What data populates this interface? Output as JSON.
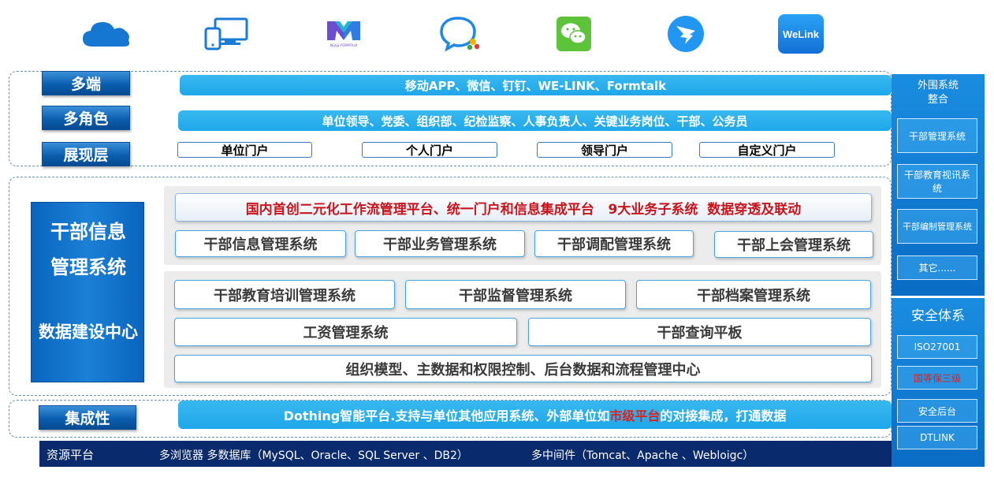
{
  "icons": [
    {
      "name": "cloud-icon",
      "color": "#1677d2"
    },
    {
      "name": "devices-icon",
      "color": "#1a7bd6"
    },
    {
      "name": "formtalk-logo-icon",
      "color": "#6c4ccf",
      "logo_text": "移动云·FORMTALK"
    },
    {
      "name": "chat-bubble-icon",
      "color": "#1e88e5"
    },
    {
      "name": "wechat-icon",
      "color": "#5cc33a"
    },
    {
      "name": "dingtalk-icon",
      "color": "#2196f3"
    },
    {
      "name": "welink-icon",
      "color": "#1e88e5",
      "label": "WeLink"
    }
  ],
  "presentation": {
    "label_terminal": "多端",
    "label_role": "多角色",
    "label_layer": "展现层",
    "bar_terminal": "移动APP、微信、钉钉、WE-LINK、Formtalk",
    "bar_role": "单位领导、党委、组织部、纪检监察、人事负责人、关键业务岗位、干部、公务员",
    "portals": [
      "单位门户",
      "个人门户",
      "领导门户",
      "自定义门户"
    ]
  },
  "core": {
    "left_title_1": "干部信息",
    "left_title_2": "管理系统",
    "left_title_3": "数据建设中心",
    "banner": "国内首创二元化工作流管理平台、统一门户和信息集成平台   9大业务子系统  数据穿透及联动",
    "row1": [
      "干部信息管理系统",
      "干部业务管理系统",
      "干部调配管理系统",
      "干部上会管理系统"
    ],
    "row2": [
      "干部教育培训管理系统",
      "干部监督管理系统",
      "干部档案管理系统"
    ],
    "row3": [
      "工资管理系统",
      "干部查询平板"
    ],
    "row4": "组织模型、主数据和权限控制、后台数据和流程管理中心"
  },
  "integration": {
    "label": "集成性",
    "bar_before": "Dothing智能平台.支持与单位其他应用系统、外部单位如",
    "bar_highlight": "市级平台",
    "bar_after": "的对接集成，打通数据",
    "highlight_color": "#e0201c"
  },
  "resource": {
    "label": "资源平台",
    "browsers_db": "多浏览器 多数据库（MySQL、Oracle、SQL Server 、DB2）",
    "middleware": "多中间件（Tomcat、Apache 、Webloigc）"
  },
  "sidebar": {
    "periph_title": "外围系统\n整合",
    "periph_items": [
      "干部管理系统",
      "干部教育视讯系统",
      "干部编制管理系统",
      "其它......"
    ],
    "security_title": "安全体系",
    "security_items": [
      "ISO27001",
      "国等保三级",
      "安全后台",
      "DTLINK"
    ],
    "security_highlight_color": "#e0201c"
  },
  "colors": {
    "banner_text": "#c8141c",
    "navy": "#0a2a6e"
  }
}
